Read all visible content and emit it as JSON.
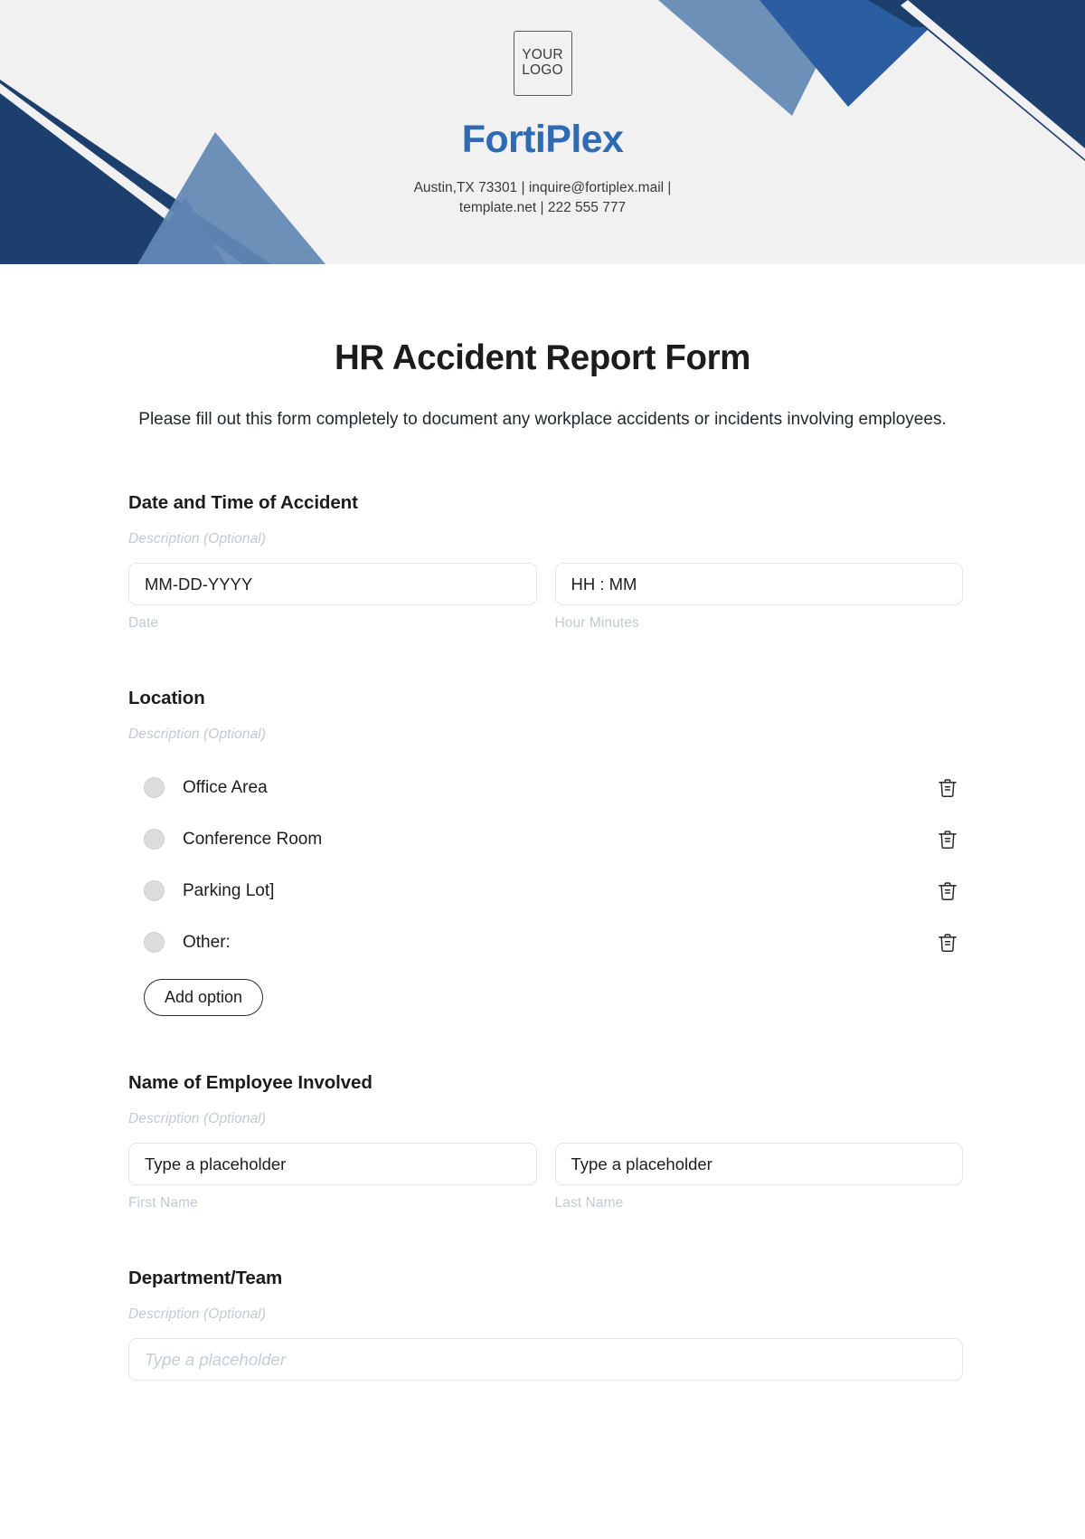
{
  "header": {
    "logo": {
      "line1": "YOUR",
      "line2": "LOGO",
      "alt": "your-logo-placeholder"
    },
    "brand": "FortiPlex",
    "contact_line1": "Austin,TX 73301 | inquire@fortiplex.mail |",
    "contact_line2": "template.net | 222 555 777",
    "colors": {
      "background": "#f1f1f1",
      "brand_blue": "#2f6bb3",
      "dark_navy": "#1d3f6e",
      "mid_blue": "#2b5ea0",
      "light_blue": "#6288b4"
    }
  },
  "form": {
    "title": "HR Accident Report Form",
    "subtitle": "Please fill out this form completely to document any workplace accidents or incidents involving employees.",
    "sections": [
      {
        "id": "date-time-of-accident",
        "title": "Date and Time of Accident",
        "description": "Description (Optional)",
        "type": "two-inputs",
        "fields": [
          {
            "name": "date",
            "value": "MM-DD-YYYY",
            "sub_label": "Date",
            "muted": false
          },
          {
            "name": "hour-minutes",
            "value": "HH : MM",
            "sub_label": "Hour Minutes",
            "muted": false
          }
        ]
      },
      {
        "id": "location",
        "title": "Location",
        "description": "Description (Optional)",
        "type": "radio-options",
        "options": [
          {
            "label": "Office Area",
            "selected": false,
            "delete_icon": "trash-icon"
          },
          {
            "label": "Conference Room",
            "selected": false,
            "delete_icon": "trash-icon"
          },
          {
            "label": "Parking Lot]",
            "selected": false,
            "delete_icon": "trash-icon"
          },
          {
            "label": "Other:",
            "selected": false,
            "delete_icon": "trash-icon"
          }
        ],
        "add_option_label": "Add option"
      },
      {
        "id": "name-of-employee-involved",
        "title": "Name of Employee Involved",
        "description": "Description (Optional)",
        "type": "two-inputs",
        "fields": [
          {
            "name": "first-name",
            "value": "Type a placeholder",
            "sub_label": "First Name",
            "muted": false
          },
          {
            "name": "last-name",
            "value": "Type a placeholder",
            "sub_label": "Last Name",
            "muted": false
          }
        ]
      },
      {
        "id": "department-team",
        "title": "Department/Team",
        "description": "Description (Optional)",
        "type": "single-input",
        "fields": [
          {
            "name": "department-team",
            "value": "Type a placeholder",
            "sub_label": "",
            "muted": true
          }
        ]
      }
    ]
  }
}
